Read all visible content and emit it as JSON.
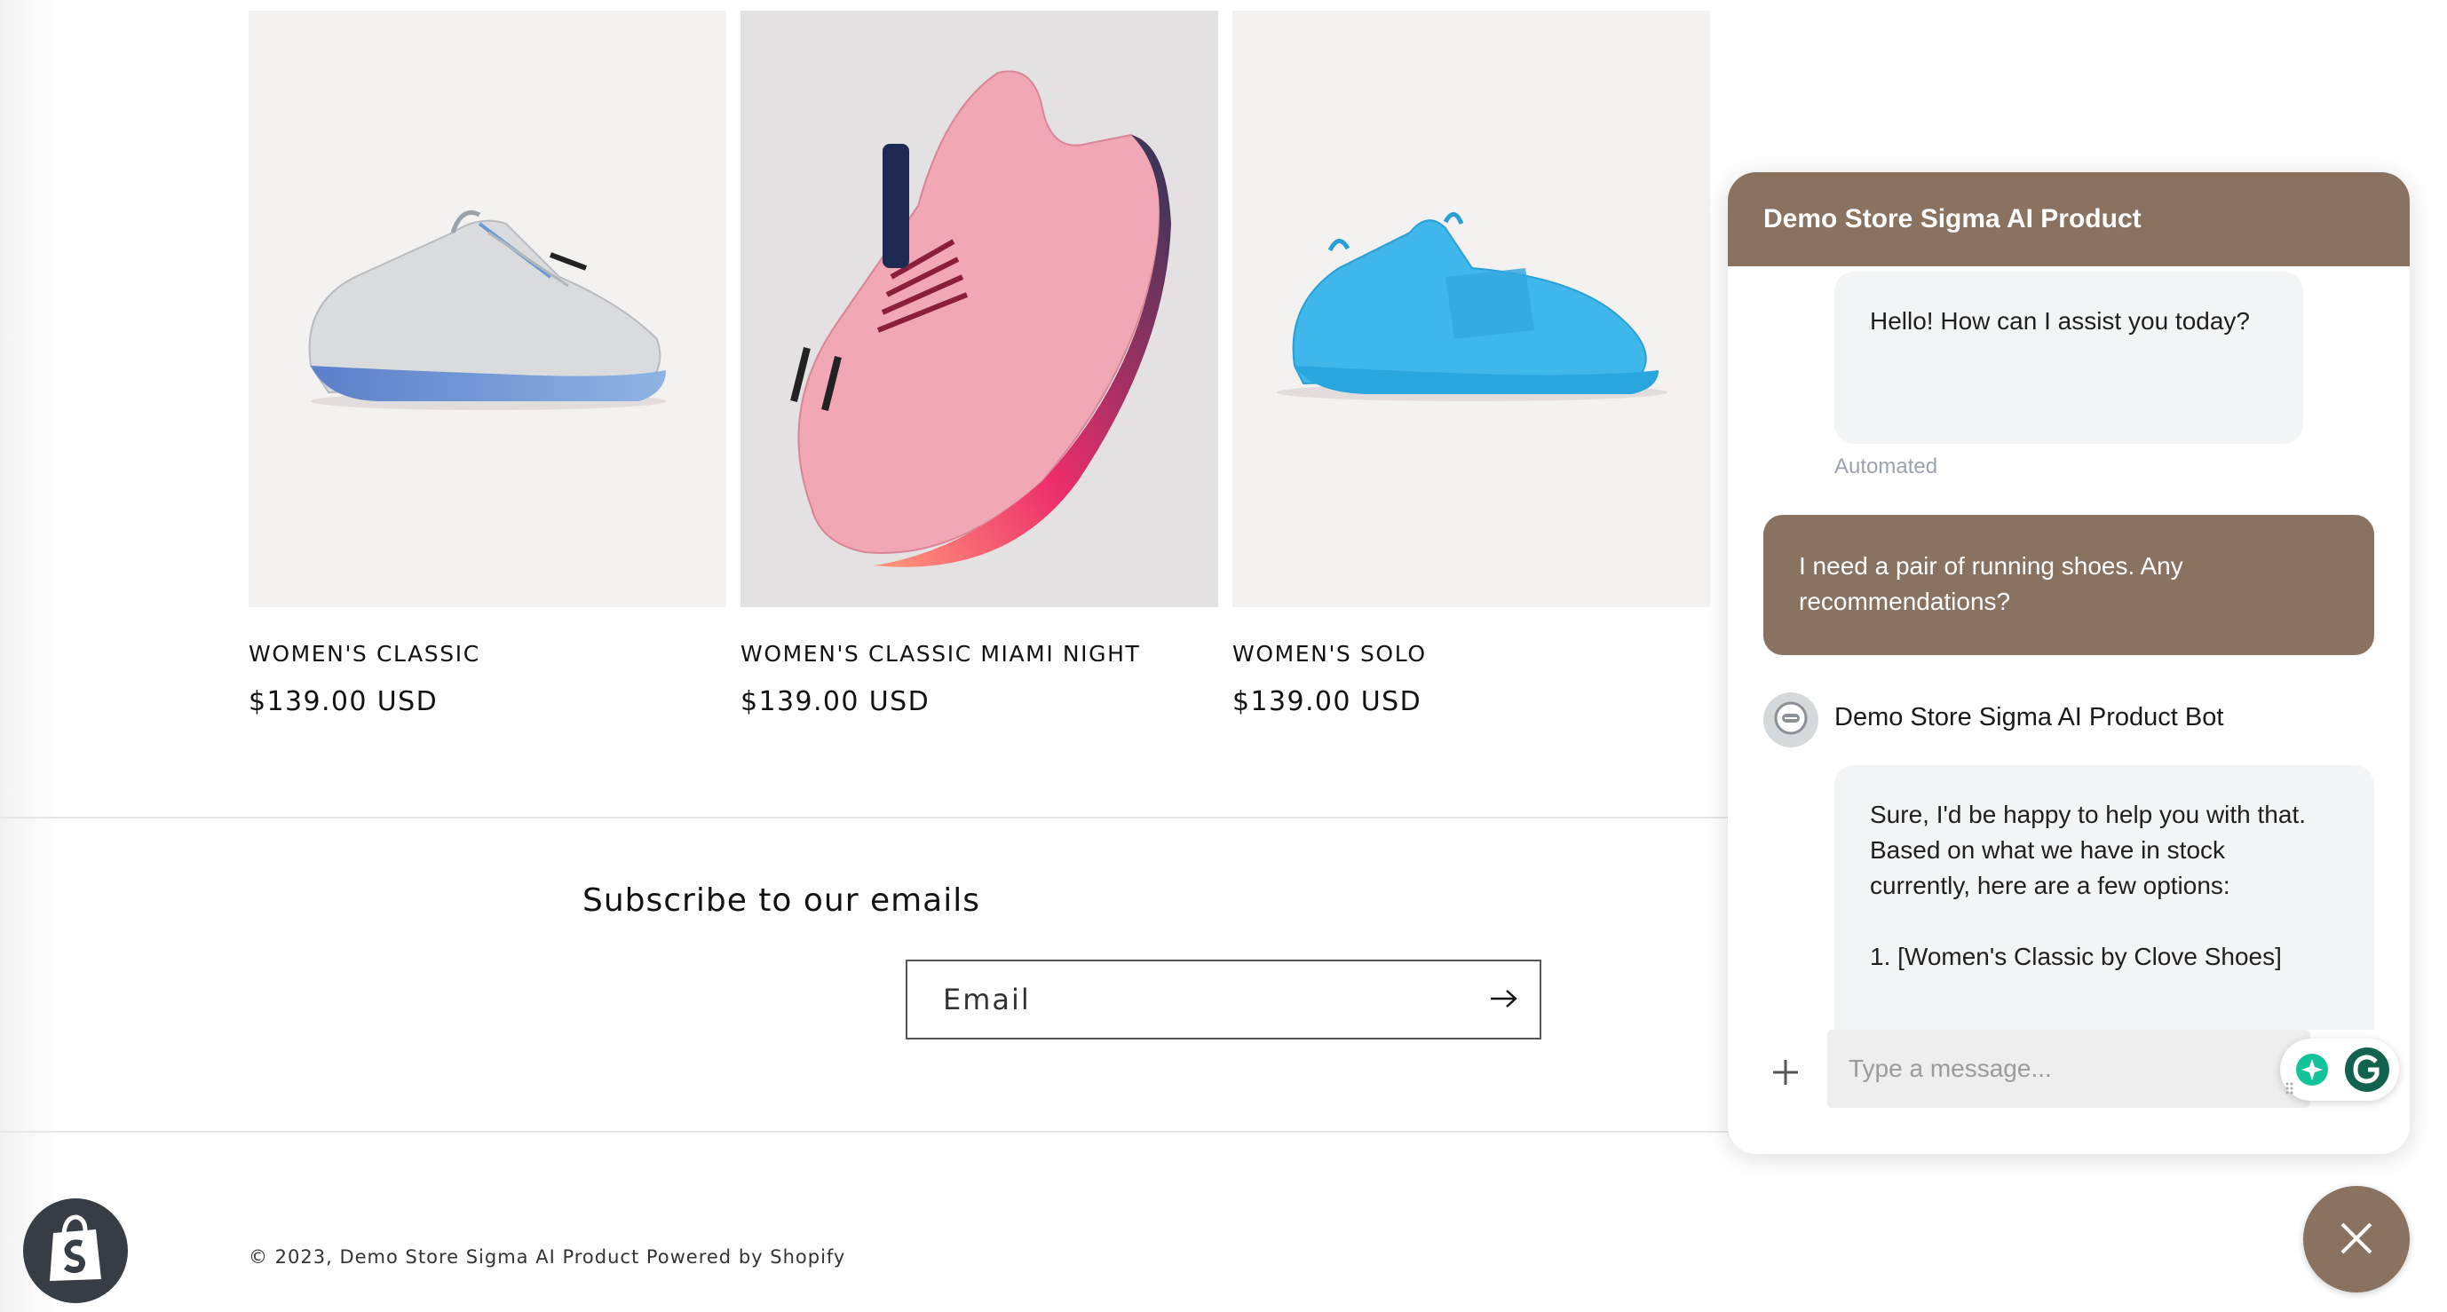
{
  "products": [
    {
      "title": "WOMEN'S CLASSIC",
      "price": "$139.00 USD",
      "image_alt": "gray sneaker with blue sole"
    },
    {
      "title": "WOMEN'S CLASSIC MIAMI NIGHT",
      "price": "$139.00 USD",
      "image_alt": "pink sneaker with navy sole"
    },
    {
      "title": "WOMEN'S SOLO",
      "price": "$139.00 USD",
      "image_alt": "light blue slip-on sneaker"
    }
  ],
  "newsletter": {
    "heading": "Subscribe to our emails",
    "email_placeholder": "Email"
  },
  "footer": {
    "copyright": "© 2023, Demo Store Sigma AI Product Powered by Shopify"
  },
  "chat": {
    "header_title": "Demo Store Sigma AI Product",
    "greeting": "Hello! How can I assist you today?",
    "automated_label": "Automated",
    "user_message_line1": "I need a pair of running shoes. Any",
    "user_message_line2": "recommendations?",
    "bot_name": "Demo Store Sigma AI Product Bot",
    "bot_reply_lines": [
      "Sure, I'd be happy to help you with that.",
      "Based on what we have in stock",
      "currently, here are a few options:",
      "",
      "1. [Women's Classic by Clove Shoes]"
    ],
    "input_placeholder": "Type a message..."
  },
  "colors": {
    "brand": "#8a7260",
    "bot_bubble": "#f3f4f6",
    "product_bg": "#f4f1f1",
    "grammarly_green": "#15c39a"
  },
  "icons": {
    "submit": "arrow-right-icon",
    "add": "plus-icon",
    "close": "close-icon",
    "shopify": "shopify-bag-icon",
    "grammarly": "grammarly-icon",
    "bot": "bot-avatar-icon"
  }
}
